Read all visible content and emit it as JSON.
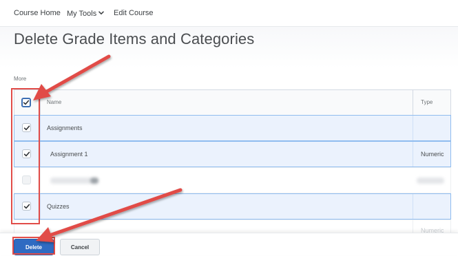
{
  "nav": {
    "course_home": "Course Home",
    "my_tools": "My Tools",
    "edit_course": "Edit Course"
  },
  "page": {
    "title": "Delete Grade Items and Categories",
    "more_label": "More"
  },
  "table": {
    "columns": {
      "name": "Name",
      "type": "Type"
    },
    "header_checked": true,
    "rows": [
      {
        "name": "Assignments",
        "type": "",
        "checked": true
      },
      {
        "name": "Assignment 1",
        "type": "Numeric",
        "checked": true
      },
      {
        "name": "",
        "type": "",
        "checked": false,
        "obscured": true
      },
      {
        "name": "Quizzes",
        "type": "",
        "checked": true
      }
    ]
  },
  "footer": {
    "delete_label": "Delete",
    "cancel_label": "Cancel",
    "partial_type_behind": "Numeric"
  },
  "colors": {
    "primary_button": "#2f6bc2",
    "selected_row": "#ebf2fd",
    "annotation": "#e14b47"
  },
  "icons": {
    "checkbox_check": "check-icon",
    "dropdown": "chevron-down-icon"
  }
}
